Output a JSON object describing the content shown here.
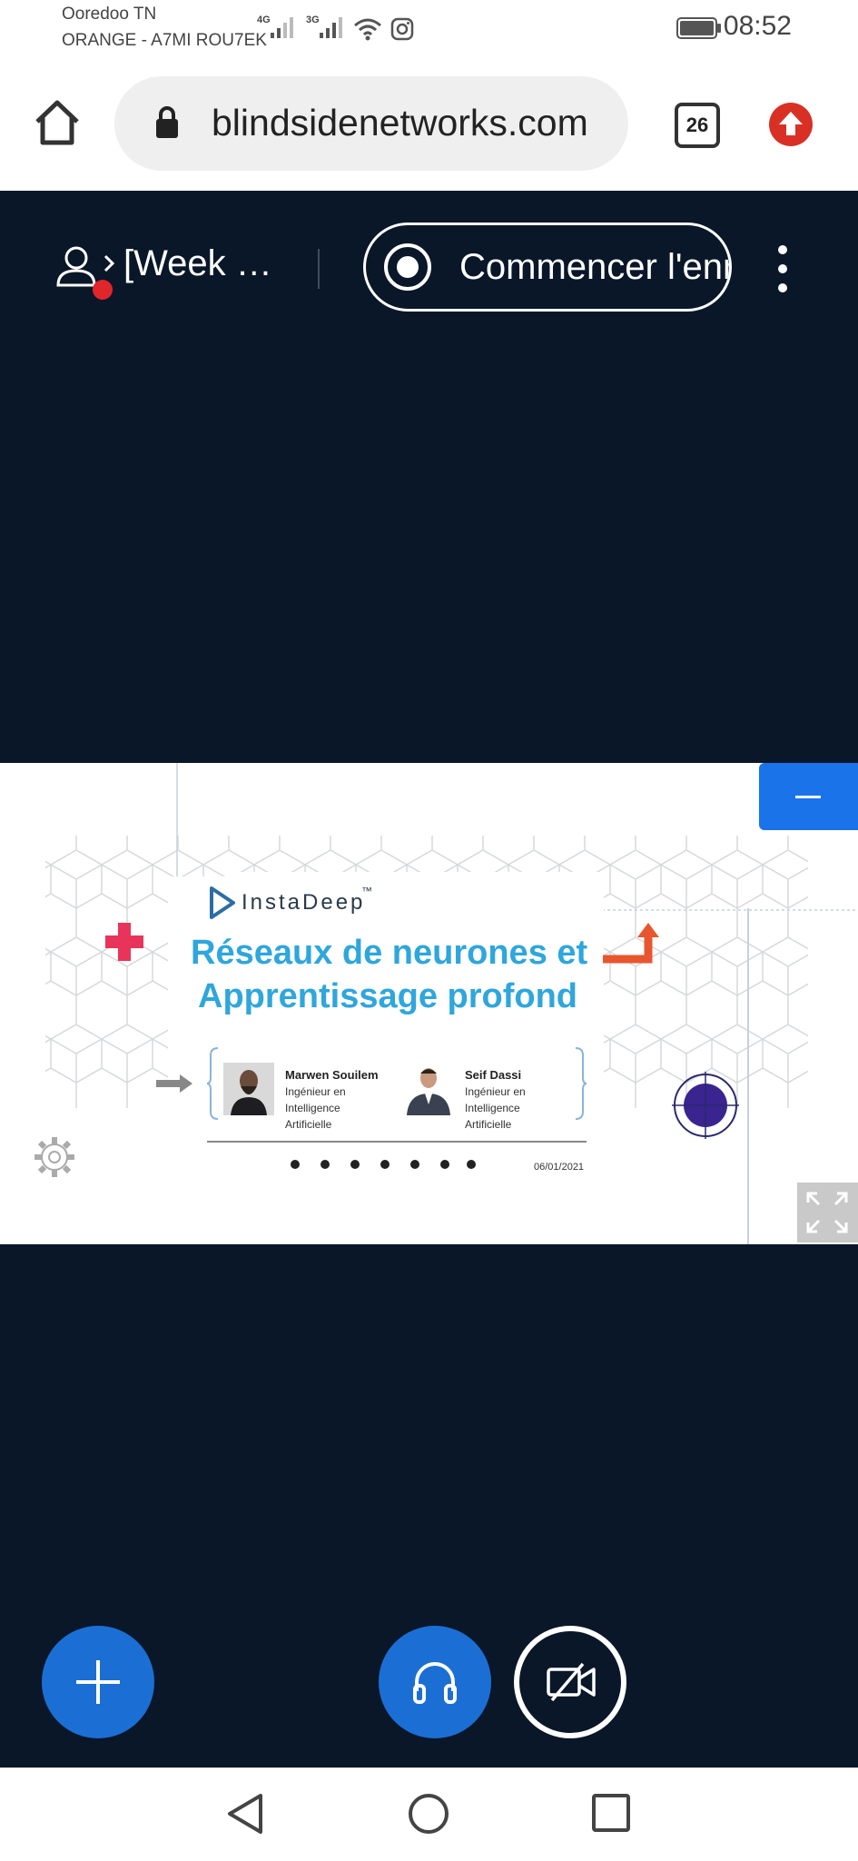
{
  "status_bar": {
    "carrier_line1": "Ooredoo TN",
    "carrier_line2": "ORANGE - A7MI ROU7EK",
    "network1": "4G",
    "network2": "3G",
    "time": "08:52"
  },
  "browser": {
    "url": "blindsidenetworks.com",
    "tab_count": "26",
    "icons": [
      "home-icon",
      "lock-icon",
      "tab-switcher-icon",
      "update-icon"
    ]
  },
  "meeting": {
    "title": "[Week …",
    "record_label": "Commencer l'enr",
    "icons": [
      "user-icon",
      "chevron-right-icon",
      "record-icon",
      "more-vert-icon"
    ]
  },
  "slide": {
    "brand": "InstaDeep",
    "brand_tm": "™",
    "headline_line1": "Réseaux de neurones et",
    "headline_line2": "Apprentissage profond",
    "presenters": [
      {
        "name": "Marwen Souilem",
        "role_line1": "Ingénieur en",
        "role_line2": "Intelligence",
        "role_line3": "Artificielle"
      },
      {
        "name": "Seif Dassi",
        "role_line1": "Ingénieur en",
        "role_line2": "Intelligence",
        "role_line3": "Artificielle"
      }
    ],
    "date": "06/01/2021",
    "page_dots": 7
  },
  "controls": {
    "icons": [
      "plus-icon",
      "headphones-icon",
      "video-off-icon",
      "minimize-icon",
      "fullscreen-icon"
    ]
  },
  "navbar": {
    "icons": [
      "back-icon",
      "home-circle-icon",
      "recents-icon"
    ]
  },
  "colors": {
    "meeting_bg": "#091729",
    "accent_blue": "#1b6fd4",
    "headline": "#2fa6dc",
    "red_dot": "#e0262b",
    "pink_plus": "#e8345a",
    "orange_arrow": "#e8562f",
    "purple_dot": "#3a2490"
  }
}
